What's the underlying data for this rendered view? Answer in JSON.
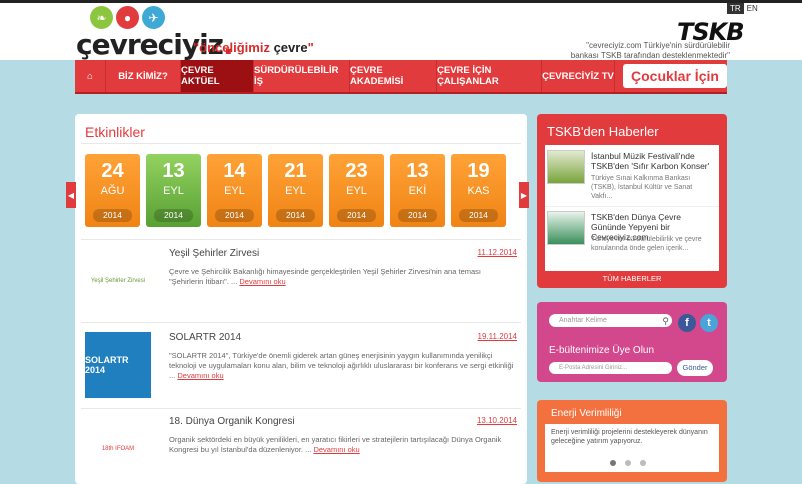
{
  "header": {
    "logo_text": "çevreciyiz",
    "slogan_main": "\"önceliğimiz ",
    "slogan_bold": "çevre",
    "slogan_end": "\"",
    "lang_active": "TR",
    "lang_other": "EN",
    "tskb_logo": "TSKB",
    "tskb_note": "\"cevreciyiz.com Türkiye'nin sürdürülebilir bankası TSKB tarafından desteklenmektedir\""
  },
  "nav": {
    "items": [
      "BİZ KİMİZ?",
      "ÇEVRE AKTÜEL",
      "SÜRDÜRÜLEBİLİR İŞ",
      "ÇEVRE AKADEMİSİ",
      "ÇEVRE İÇİN ÇALIŞANLAR",
      "ÇEVRECİYİZ TV"
    ],
    "kids": "Çocuklar İçin"
  },
  "events": {
    "title": "Etkinlikler",
    "dates": [
      {
        "day": "24",
        "month": "AĞU",
        "year": "2014"
      },
      {
        "day": "13",
        "month": "EYL",
        "year": "2014"
      },
      {
        "day": "14",
        "month": "EYL",
        "year": "2014"
      },
      {
        "day": "21",
        "month": "EYL",
        "year": "2014"
      },
      {
        "day": "23",
        "month": "EYL",
        "year": "2014"
      },
      {
        "day": "13",
        "month": "EKİ",
        "year": "2014"
      },
      {
        "day": "19",
        "month": "KAS",
        "year": "2014"
      }
    ],
    "items": [
      {
        "title": "Yeşil Şehirler Zirvesi",
        "date": "11.12.2014",
        "img_caption": "Yeşil Şehirler Zirvesi",
        "desc": "Çevre ve Şehircilik Bakanlığı himayesinde gerçekleştirilen Yeşil Şehirler Zirvesi'nin ana teması \"Şehirlerin İtibarı\".",
        "more": "Devamını oku"
      },
      {
        "title": "SOLARTR 2014",
        "date": "19.11.2014",
        "img_caption": "SOLARTR 2014",
        "desc": "\"SOLARTR 2014\", Türkiye'de önemli giderek artan güneş enerjisinin yaygın kullanımında yenilikçi teknoloji ve uygulamaları konu alan, bilim ve teknoloji ağırlıklı uluslararası bir konferans ve sergi etkinliği ...",
        "more": "Devamını oku"
      },
      {
        "title": "18. Dünya Organik Kongresi",
        "date": "13.10.2014",
        "img_caption": "18th IFOAM",
        "desc": "Organik sektördeki en büyük yenilikleri, en yaratıcı fikirleri ve stratejilerin tartışılacağı Dünya Organik Kongresi bu yıl İstanbul'da düzenleniyor.",
        "more": "Devamını oku"
      }
    ]
  },
  "tskb_news": {
    "title": "TSKB'den Haberler",
    "items": [
      {
        "title": "İstanbul Müzik Festivali'nde TSKB'den 'Sıfır Karbon Konser'",
        "desc": "Türkiye Sınai Kalkınma Bankası (TSKB), İstanbul Kültür ve Sanat Vakfı..."
      },
      {
        "title": "TSKB'den Dünya Çevre Gününde Yepyeni bir Cevreciyiz.com",
        "desc": "Türkiye'nin sürdürülebilirlik ve çevre konularında önde gelen içerik..."
      }
    ],
    "all": "TÜM HABERLER"
  },
  "search": {
    "placeholder": "Anahtar Kelime"
  },
  "newsletter": {
    "title": "E-bültenimize Üye Olun",
    "placeholder": "E-Posta Adresini Giriniz...",
    "send": "Gönder"
  },
  "energy": {
    "title": "Enerji Verimliliği",
    "desc": "Enerji verimliliği projelerini destekleyerek dünyanın geleceğine yatırım yapıyoruz."
  },
  "colors": {
    "brand_red": "#e23b3e",
    "orange": "#f08414",
    "green": "#58a033",
    "pink": "#d3478c"
  }
}
